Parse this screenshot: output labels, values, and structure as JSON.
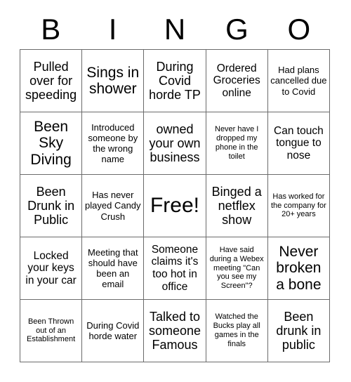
{
  "card": {
    "title": "BINGO",
    "header_letters": [
      "B",
      "I",
      "N",
      "G",
      "O"
    ],
    "colors": {
      "background": "#ffffff",
      "text": "#000000",
      "grid_line": "#6b6b6b"
    },
    "rows": [
      [
        {
          "text": "Pulled over for speeding",
          "size": "fs-lg",
          "free": false
        },
        {
          "text": "Sings in shower",
          "size": "fs-xl",
          "free": false
        },
        {
          "text": "During Covid horde TP",
          "size": "fs-lg",
          "free": false
        },
        {
          "text": "Ordered Groceries online",
          "size": "fs-md",
          "free": false
        },
        {
          "text": "Had plans cancelled due to Covid",
          "size": "fs-sm",
          "free": false
        }
      ],
      [
        {
          "text": "Been Sky Diving",
          "size": "fs-xl",
          "free": false
        },
        {
          "text": "Introduced someone by the wrong name",
          "size": "fs-sm",
          "free": false
        },
        {
          "text": "owned your own business",
          "size": "fs-lg",
          "free": false
        },
        {
          "text": "Never have I dropped my phone in the toilet",
          "size": "fs-xs",
          "free": false
        },
        {
          "text": "Can touch tongue to nose",
          "size": "fs-md",
          "free": false
        }
      ],
      [
        {
          "text": "Been Drunk in Public",
          "size": "fs-lg",
          "free": false
        },
        {
          "text": "Has never played Candy Crush",
          "size": "fs-sm",
          "free": false
        },
        {
          "text": "Free!",
          "size": "fs-xxl",
          "free": true
        },
        {
          "text": "Binged a netflex show",
          "size": "fs-lg",
          "free": false
        },
        {
          "text": "Has worked for the company for 20+ years",
          "size": "fs-xs",
          "free": false
        }
      ],
      [
        {
          "text": "Locked your keys in your car",
          "size": "fs-md",
          "free": false
        },
        {
          "text": "Meeting that should have been an email",
          "size": "fs-sm",
          "free": false
        },
        {
          "text": "Someone claims it's too hot in office",
          "size": "fs-md",
          "free": false
        },
        {
          "text": "Have said during a Webex meeting \"Can you see my Screen\"?",
          "size": "fs-xs",
          "free": false
        },
        {
          "text": "Never broken a bone",
          "size": "fs-xl",
          "free": false
        }
      ],
      [
        {
          "text": "Been Thrown out of an Establishment",
          "size": "fs-xs",
          "free": false
        },
        {
          "text": "During Covid horde water",
          "size": "fs-sm",
          "free": false
        },
        {
          "text": "Talked to someone Famous",
          "size": "fs-lg",
          "free": false
        },
        {
          "text": "Watched the Bucks play all games in the finals",
          "size": "fs-xs",
          "free": false
        },
        {
          "text": "Been drunk in public",
          "size": "fs-lg",
          "free": false
        }
      ]
    ]
  }
}
